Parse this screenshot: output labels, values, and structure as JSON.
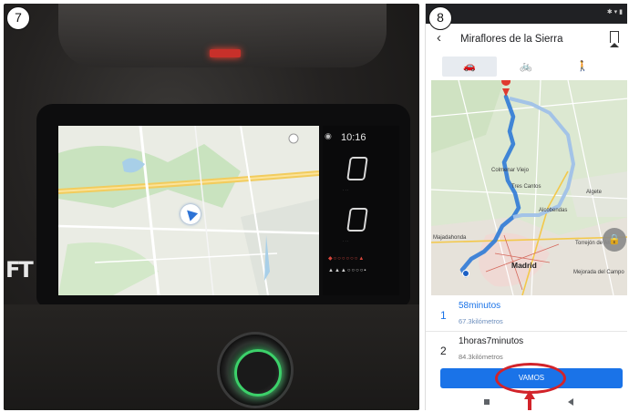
{
  "panel_labels": {
    "left": "7",
    "right": "8"
  },
  "dashboard": {
    "clock": "10:16",
    "gear_display_top": "0",
    "gear_display_bottom": "0",
    "speedometer_text": "",
    "brand_mark": "FT"
  },
  "phone": {
    "app_bar": {
      "back_icon": "arrow-back-icon",
      "title": "Miraflores de la Sierra",
      "bookmark_icon": "bookmark-icon"
    },
    "modes": [
      {
        "label": "🚗",
        "icon": "car-icon",
        "active": true
      },
      {
        "label": "🚲",
        "icon": "bicycle-icon",
        "active": false
      },
      {
        "label": "🚶",
        "icon": "walk-icon",
        "active": false
      }
    ],
    "map_labels": {
      "colmenar": "Colmenar Viejo",
      "tres_cantos": "Tres Cantos",
      "alcobendas": "Alcobendas",
      "algete": "Algete",
      "majadahonda": "Majadahonda",
      "madrid": "Madrid",
      "torrejon": "Torrejón de Ardoz",
      "mejorada": "Mejorada del Campo"
    },
    "routes": [
      {
        "number": "1",
        "time": "58minutos",
        "distance": "67.3kilómetros",
        "selected": true
      },
      {
        "number": "2",
        "time": "1horas7minutos",
        "distance": "84.3kilómetros",
        "selected": false
      }
    ],
    "go_button": "VAMOS",
    "colors": {
      "accent": "#1a73e8",
      "highlight": "#d2232a",
      "route_main": "#4a8fd8",
      "route_alt": "#9ec0e6"
    }
  }
}
